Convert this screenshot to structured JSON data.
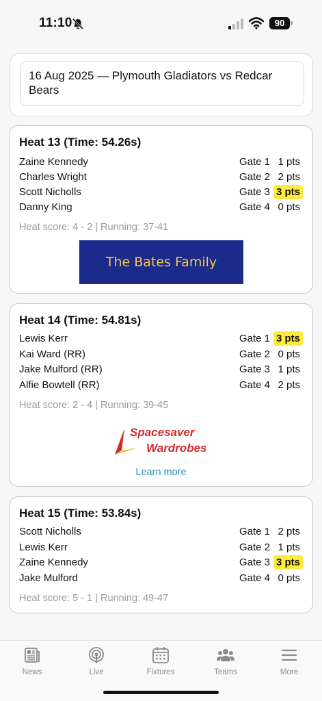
{
  "status_bar": {
    "time": "11:10",
    "battery": "90"
  },
  "fixture": {
    "title": "16 Aug 2025 — Plymouth Gladiators vs Redcar Bears"
  },
  "heats": [
    {
      "title": "Heat  13 (Time: 54.26s)",
      "riders": [
        {
          "name": "Zaine Kennedy",
          "gate": "Gate 1",
          "pts": "1 pts",
          "win": false
        },
        {
          "name": "Charles Wright",
          "gate": "Gate 2",
          "pts": "2 pts",
          "win": false
        },
        {
          "name": "Scott Nicholls",
          "gate": "Gate 3",
          "pts": "3 pts",
          "win": true
        },
        {
          "name": "Danny King",
          "gate": "Gate 4",
          "pts": "0 pts",
          "win": false
        }
      ],
      "score": "Heat score: 4 - 2  |  Running: 37-41",
      "ad": {
        "text": "The Bates Family"
      }
    },
    {
      "title": "Heat  14 (Time: 54.81s)",
      "riders": [
        {
          "name": "Lewis Kerr",
          "gate": "Gate 1",
          "pts": "3 pts",
          "win": true
        },
        {
          "name": "Kai Ward (RR)",
          "gate": "Gate 2",
          "pts": "0 pts",
          "win": false
        },
        {
          "name": "Jake Mulford (RR)",
          "gate": "Gate 3",
          "pts": "1 pts",
          "win": false
        },
        {
          "name": "Alfie Bowtell (RR)",
          "gate": "Gate 4",
          "pts": "2 pts",
          "win": false
        }
      ],
      "score": "Heat score: 2 - 4  |  Running: 39-45",
      "ad": {
        "line1": "Spacesaver",
        "line2": "Wardrobes",
        "link": "Learn more"
      }
    },
    {
      "title": "Heat  15 (Time: 53.84s)",
      "riders": [
        {
          "name": "Scott Nicholls",
          "gate": "Gate 1",
          "pts": "2 pts",
          "win": false
        },
        {
          "name": "Lewis Kerr",
          "gate": "Gate 2",
          "pts": "1 pts",
          "win": false
        },
        {
          "name": "Zaine Kennedy",
          "gate": "Gate 3",
          "pts": "3 pts",
          "win": true
        },
        {
          "name": "Jake Mulford",
          "gate": "Gate 4",
          "pts": "0 pts",
          "win": false
        }
      ],
      "score": "Heat score: 5 - 1  |  Running: 49-47"
    }
  ],
  "tabs": [
    {
      "label": "News",
      "icon": "newspaper-icon"
    },
    {
      "label": "Live",
      "icon": "broadcast-icon"
    },
    {
      "label": "Fixtures",
      "icon": "calendar-icon"
    },
    {
      "label": "Teams",
      "icon": "people-icon"
    },
    {
      "label": "More",
      "icon": "menu-icon"
    }
  ],
  "colors": {
    "win_highlight": "#ffeb3b",
    "link": "#2a8bc6",
    "ad_bates_bg": "#1c2a8c",
    "ad_bates_text": "#f3c94a",
    "spacesaver_red": "#d42a2a"
  }
}
